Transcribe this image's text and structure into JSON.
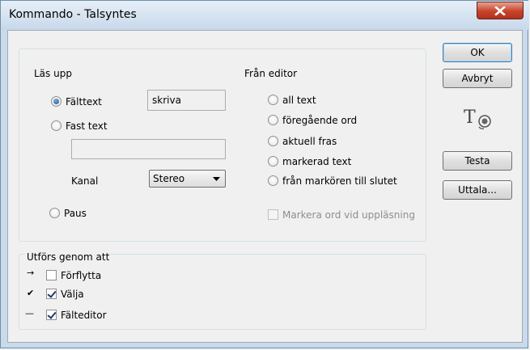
{
  "window": {
    "title": "Kommando - Talsyntes"
  },
  "read_group": {
    "title": "Läs upp",
    "options": {
      "field_text": {
        "label": "Fälttext",
        "value": "skriva",
        "checked": true
      },
      "fixed_text": {
        "label": "Fast text",
        "value": "",
        "checked": false
      },
      "pause": {
        "label": "Paus",
        "checked": false
      }
    },
    "channel": {
      "label": "Kanal",
      "selected": "Stereo"
    }
  },
  "from_editor": {
    "title": "Från editor",
    "options": [
      "all text",
      "föregående ord",
      "aktuell fras",
      "markerad text",
      "från markören till slutet"
    ],
    "highlight_checkbox": {
      "label": "Markera ord vid uppläsning",
      "checked": false,
      "enabled": false
    }
  },
  "performed_by": {
    "title": "Utförs genom att",
    "items": [
      {
        "label": "Förflytta",
        "checked": false,
        "marker": "→"
      },
      {
        "label": "Välja",
        "checked": true,
        "marker": "✔"
      },
      {
        "label": "Fälteditor",
        "checked": true,
        "marker": "—"
      }
    ]
  },
  "buttons": {
    "ok": "OK",
    "cancel": "Avbryt",
    "test": "Testa",
    "speak": "Uttala..."
  },
  "icons": {
    "speech": "text-to-speech-icon"
  }
}
